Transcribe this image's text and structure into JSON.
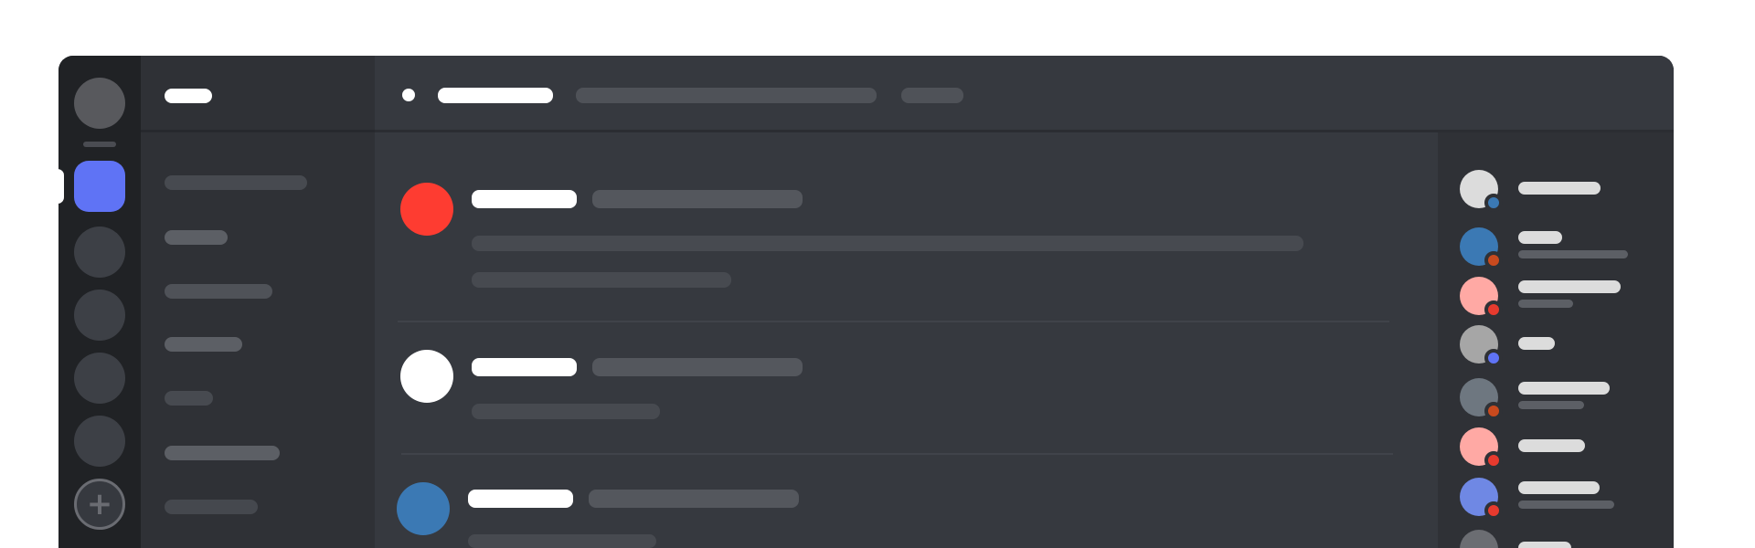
{
  "app": {
    "title": ""
  },
  "server_rail": {
    "home_icon": "home-avatar",
    "active_color": "#5f73f5",
    "add_icon": "plus-icon",
    "add_glyph": "+"
  },
  "colors": {
    "rail_bg": "#202225",
    "sidebar_bg": "#2f3136",
    "main_bg": "#36393f",
    "placeholder_bar": "#4f5258",
    "text_bar": "#ffffff"
  },
  "messages": [
    {
      "avatar_color": "#fe3c31"
    },
    {
      "avatar_color": "#ffffff"
    },
    {
      "avatar_color": "#3b79b4"
    }
  ],
  "members": [
    {
      "avatar_color": "#dcdcdc",
      "status_color": "#3b79b4"
    },
    {
      "avatar_color": "#3b79b4",
      "status_color": "#c94a1e"
    },
    {
      "avatar_color": "#ffa9a4",
      "status_color": "#e73a2e"
    },
    {
      "avatar_color": "#a6a6a6",
      "status_color": "#5f73f5"
    },
    {
      "avatar_color": "#6e7780",
      "status_color": "#c94a1e"
    },
    {
      "avatar_color": "#ffa9a4",
      "status_color": "#e73a2e"
    },
    {
      "avatar_color": "#6f88e4",
      "status_color": "#e73a2e"
    },
    {
      "avatar_color": "#6b6d72",
      "status_color": "#6b6d72"
    }
  ]
}
